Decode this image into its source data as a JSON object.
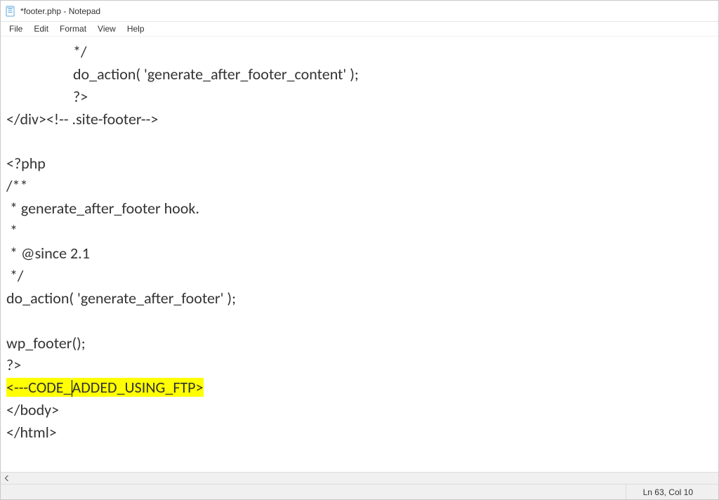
{
  "window": {
    "title": "*footer.php - Notepad"
  },
  "menu": {
    "file": "File",
    "edit": "Edit",
    "format": "Format",
    "view": "View",
    "help": "Help"
  },
  "code": {
    "l1": "*/",
    "l2": "do_action( 'generate_after_footer_content' );",
    "l3": "?>",
    "l4": "</div><!-- .site-footer-->",
    "l5": "",
    "l6": "<?php",
    "l7": "/**",
    "l8": " * generate_after_footer hook.",
    "l9": " *",
    "l10": " * @since 2.1",
    "l11": " */",
    "l12": "do_action( 'generate_after_footer' );",
    "l13": "",
    "l14": "wp_footer();",
    "l15": "?>",
    "hl_a": "<---CODE_",
    "hl_b": "ADDED_USING_FTP>",
    "l17": "</body>",
    "l18": "</html>"
  },
  "status": {
    "pos": "Ln 63, Col 10"
  }
}
